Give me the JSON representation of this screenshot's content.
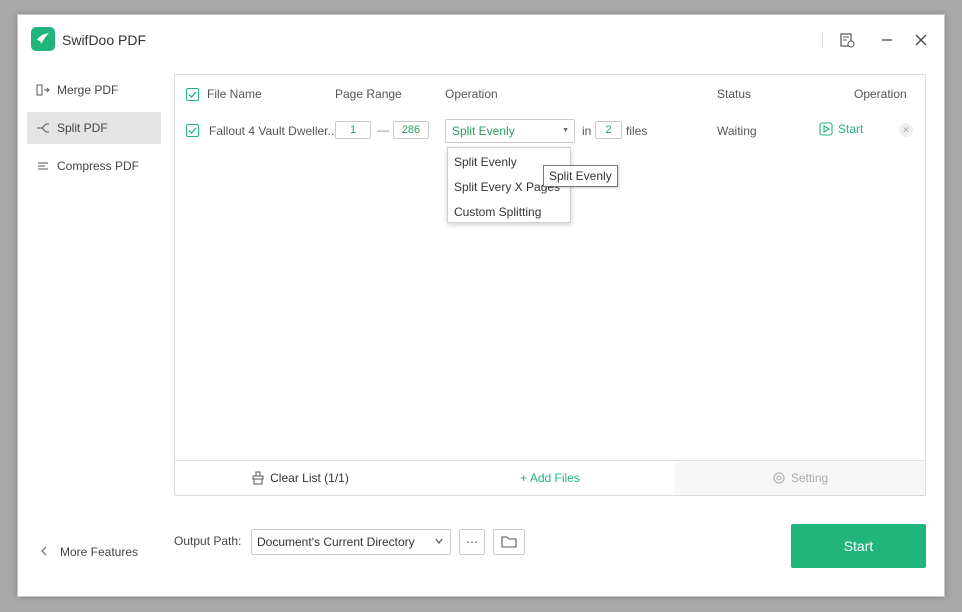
{
  "app": {
    "title": "SwifDoo PDF"
  },
  "sidebar": {
    "items": [
      {
        "label": "Merge PDF",
        "icon": "merge-icon"
      },
      {
        "label": "Split PDF",
        "icon": "split-icon"
      },
      {
        "label": "Compress PDF",
        "icon": "compress-icon"
      }
    ],
    "more_features": "More Features"
  },
  "table": {
    "headers": {
      "file_name": "File Name",
      "page_range": "Page Range",
      "operation": "Operation",
      "status": "Status",
      "operation2": "Operation"
    },
    "row": {
      "file_name": "Fallout 4 Vault Dweller...",
      "range_start": "1",
      "range_dash": "—",
      "range_end": "286",
      "operation_value": "Split Evenly",
      "in_label": "in",
      "files_count": "2",
      "files_label": "files",
      "status": "Waiting",
      "start_label": "Start"
    }
  },
  "dropdown": {
    "options": [
      "Split Evenly",
      "Split Every X Pages",
      "Custom Splitting"
    ],
    "tooltip": "Split Evenly"
  },
  "footer": {
    "clear_list": "Clear List (1/1)",
    "add_files": "+ Add Files",
    "setting": "Setting"
  },
  "output": {
    "label": "Output Path:",
    "path": "Document's Current Directory",
    "more": "⋯"
  },
  "start_button": "Start",
  "colors": {
    "accent": "#1fb57c"
  }
}
